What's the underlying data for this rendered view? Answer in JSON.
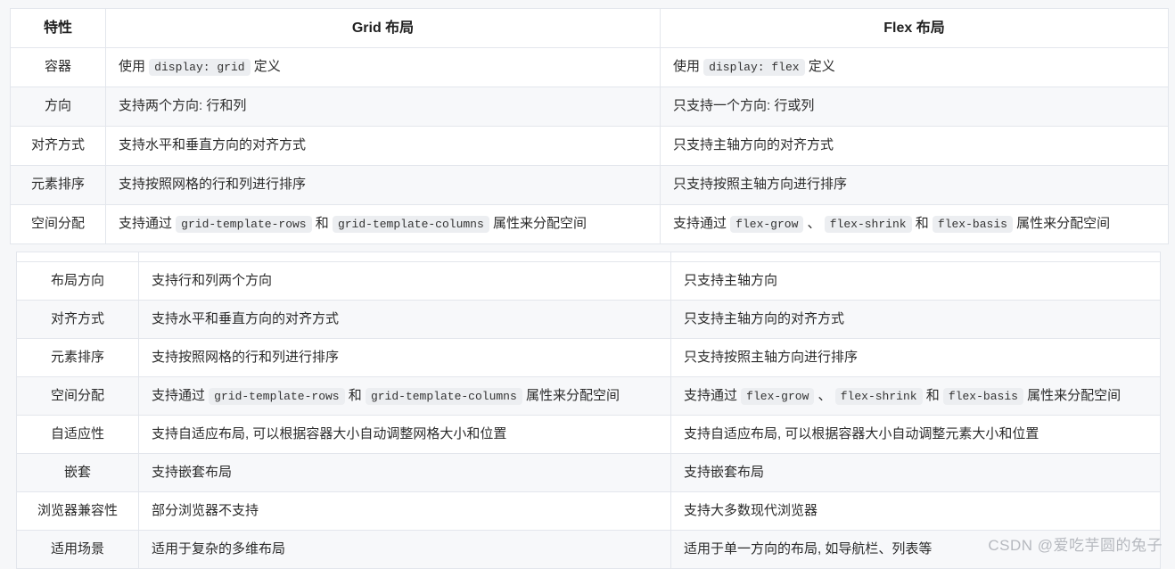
{
  "watermark": "CSDN @爱吃芋圆的兔子",
  "colors": {
    "page_background": "#f6f7f9",
    "table_background": "#ffffff",
    "stripe_background": "#f7f8fa",
    "border": "#e3e6ec",
    "outer_border": "#dfe2e8",
    "text": "#2b2b2b",
    "code_background": "#eceef1",
    "watermark": "#b6b9bf"
  },
  "table1": {
    "headers": [
      "特性",
      "Grid 布局",
      "Flex 布局"
    ],
    "rows": [
      {
        "feature": "容器",
        "grid": [
          {
            "t": "text",
            "v": "使用 "
          },
          {
            "t": "code",
            "v": "display: grid"
          },
          {
            "t": "text",
            "v": " 定义"
          }
        ],
        "flex": [
          {
            "t": "text",
            "v": "使用 "
          },
          {
            "t": "code",
            "v": "display: flex"
          },
          {
            "t": "text",
            "v": " 定义"
          }
        ]
      },
      {
        "feature": "方向",
        "grid": [
          {
            "t": "text",
            "v": "支持两个方向: 行和列"
          }
        ],
        "flex": [
          {
            "t": "text",
            "v": "只支持一个方向: 行或列"
          }
        ]
      },
      {
        "feature": "对齐方式",
        "grid": [
          {
            "t": "text",
            "v": "支持水平和垂直方向的对齐方式"
          }
        ],
        "flex": [
          {
            "t": "text",
            "v": "只支持主轴方向的对齐方式"
          }
        ]
      },
      {
        "feature": "元素排序",
        "grid": [
          {
            "t": "text",
            "v": "支持按照网格的行和列进行排序"
          }
        ],
        "flex": [
          {
            "t": "text",
            "v": "只支持按照主轴方向进行排序"
          }
        ]
      },
      {
        "feature": "空间分配",
        "grid": [
          {
            "t": "text",
            "v": "支持通过 "
          },
          {
            "t": "code",
            "v": "grid-template-rows"
          },
          {
            "t": "text",
            "v": " 和 "
          },
          {
            "t": "code",
            "v": "grid-template-columns"
          },
          {
            "t": "text",
            "v": " 属性来分配空间"
          }
        ],
        "flex": [
          {
            "t": "text",
            "v": "支持通过 "
          },
          {
            "t": "code",
            "v": "flex-grow"
          },
          {
            "t": "text",
            "v": " 、 "
          },
          {
            "t": "code",
            "v": "flex-shrink"
          },
          {
            "t": "text",
            "v": " 和 "
          },
          {
            "t": "code",
            "v": "flex-basis"
          },
          {
            "t": "text",
            "v": " 属性来分配空间"
          }
        ]
      }
    ]
  },
  "table2": {
    "headers": [
      "",
      "",
      ""
    ],
    "rows": [
      {
        "feature": "布局方向",
        "grid": [
          {
            "t": "text",
            "v": "支持行和列两个方向"
          }
        ],
        "flex": [
          {
            "t": "text",
            "v": "只支持主轴方向"
          }
        ]
      },
      {
        "feature": "对齐方式",
        "grid": [
          {
            "t": "text",
            "v": "支持水平和垂直方向的对齐方式"
          }
        ],
        "flex": [
          {
            "t": "text",
            "v": "只支持主轴方向的对齐方式"
          }
        ]
      },
      {
        "feature": "元素排序",
        "grid": [
          {
            "t": "text",
            "v": "支持按照网格的行和列进行排序"
          }
        ],
        "flex": [
          {
            "t": "text",
            "v": "只支持按照主轴方向进行排序"
          }
        ]
      },
      {
        "feature": "空间分配",
        "grid": [
          {
            "t": "text",
            "v": "支持通过 "
          },
          {
            "t": "code",
            "v": "grid-template-rows"
          },
          {
            "t": "text",
            "v": " 和 "
          },
          {
            "t": "code",
            "v": "grid-template-columns"
          },
          {
            "t": "text",
            "v": " 属性来分配空间"
          }
        ],
        "flex": [
          {
            "t": "text",
            "v": "支持通过 "
          },
          {
            "t": "code",
            "v": "flex-grow"
          },
          {
            "t": "text",
            "v": " 、 "
          },
          {
            "t": "code",
            "v": "flex-shrink"
          },
          {
            "t": "text",
            "v": " 和 "
          },
          {
            "t": "code",
            "v": "flex-basis"
          },
          {
            "t": "text",
            "v": " 属性来分配空间"
          }
        ]
      },
      {
        "feature": "自适应性",
        "grid": [
          {
            "t": "text",
            "v": "支持自适应布局, 可以根据容器大小自动调整网格大小和位置"
          }
        ],
        "flex": [
          {
            "t": "text",
            "v": "支持自适应布局, 可以根据容器大小自动调整元素大小和位置"
          }
        ]
      },
      {
        "feature": "嵌套",
        "grid": [
          {
            "t": "text",
            "v": "支持嵌套布局"
          }
        ],
        "flex": [
          {
            "t": "text",
            "v": "支持嵌套布局"
          }
        ]
      },
      {
        "feature": "浏览器兼容性",
        "grid": [
          {
            "t": "text",
            "v": "部分浏览器不支持"
          }
        ],
        "flex": [
          {
            "t": "text",
            "v": "支持大多数现代浏览器"
          }
        ]
      },
      {
        "feature": "适用场景",
        "grid": [
          {
            "t": "text",
            "v": "适用于复杂的多维布局"
          }
        ],
        "flex": [
          {
            "t": "text",
            "v": "适用于单一方向的布局, 如导航栏、列表等"
          }
        ]
      }
    ]
  }
}
